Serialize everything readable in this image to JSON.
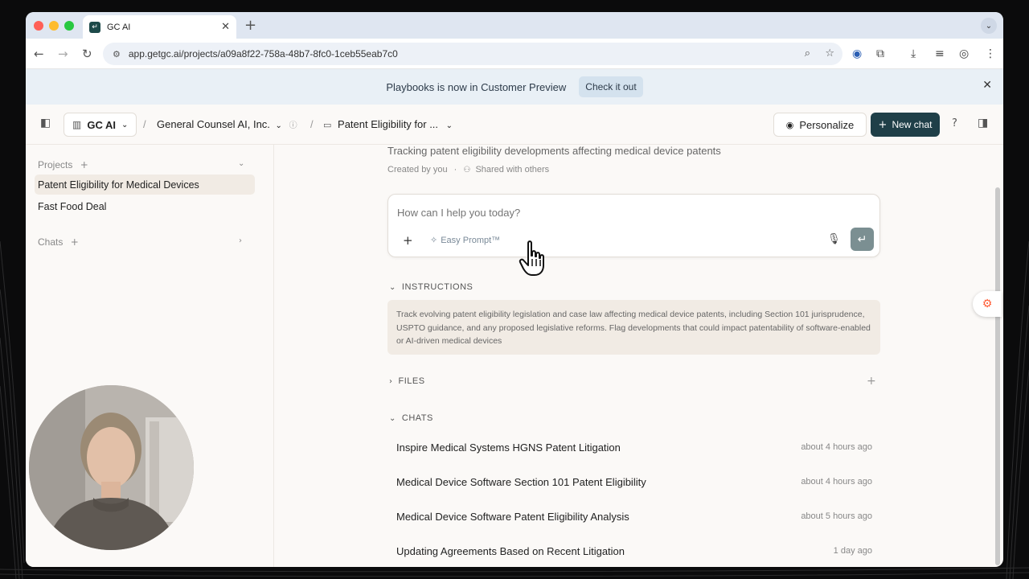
{
  "browser": {
    "tab_title": "GC AI",
    "url": "app.getgc.ai/projects/a09a8f22-758a-48b7-8fc0-1ceb55eab7c0"
  },
  "banner": {
    "text": "Playbooks is now in Customer Preview",
    "cta": "Check it out"
  },
  "header": {
    "org_button": "GC AI",
    "company": "General Counsel AI, Inc.",
    "project_crumb": "Patent Eligibility for ...",
    "personalize": "Personalize",
    "new_chat": "New chat",
    "help": "?"
  },
  "sidebar": {
    "projects_label": "Projects",
    "projects": [
      {
        "label": "Patent Eligibility for Medical Devices",
        "active": true
      },
      {
        "label": "Fast Food Deal",
        "active": false
      }
    ],
    "chats_label": "Chats"
  },
  "project": {
    "description": "Tracking patent eligibility developments affecting medical device patents",
    "created_by": "Created by you",
    "shared": "Shared with others"
  },
  "composer": {
    "placeholder": "How can I help you today?",
    "easy_prompt": "Easy Prompt™"
  },
  "instructions": {
    "title": "INSTRUCTIONS",
    "text": "Track evolving patent eligibility legislation and case law affecting medical device patents, including Section 101 jurisprudence, USPTO guidance, and any proposed legislative reforms. Flag developments that could impact patentability of software-enabled or AI-driven medical devices"
  },
  "files": {
    "title": "FILES"
  },
  "chats": {
    "title": "CHATS",
    "items": [
      {
        "title": "Inspire Medical Systems HGNS Patent Litigation",
        "time": "about 4 hours ago"
      },
      {
        "title": "Medical Device Software Section 101 Patent Eligibility",
        "time": "about 4 hours ago"
      },
      {
        "title": "Medical Device Software Patent Eligibility Analysis",
        "time": "about 5 hours ago"
      },
      {
        "title": "Updating Agreements Based on Recent Litigation",
        "time": "1 day ago"
      }
    ]
  },
  "colors": {
    "accent": "#1f3f48",
    "active_item_bg": "#f1ebe4",
    "banner_bg": "#e9f0f6",
    "hubspot": "#ff5c35"
  }
}
